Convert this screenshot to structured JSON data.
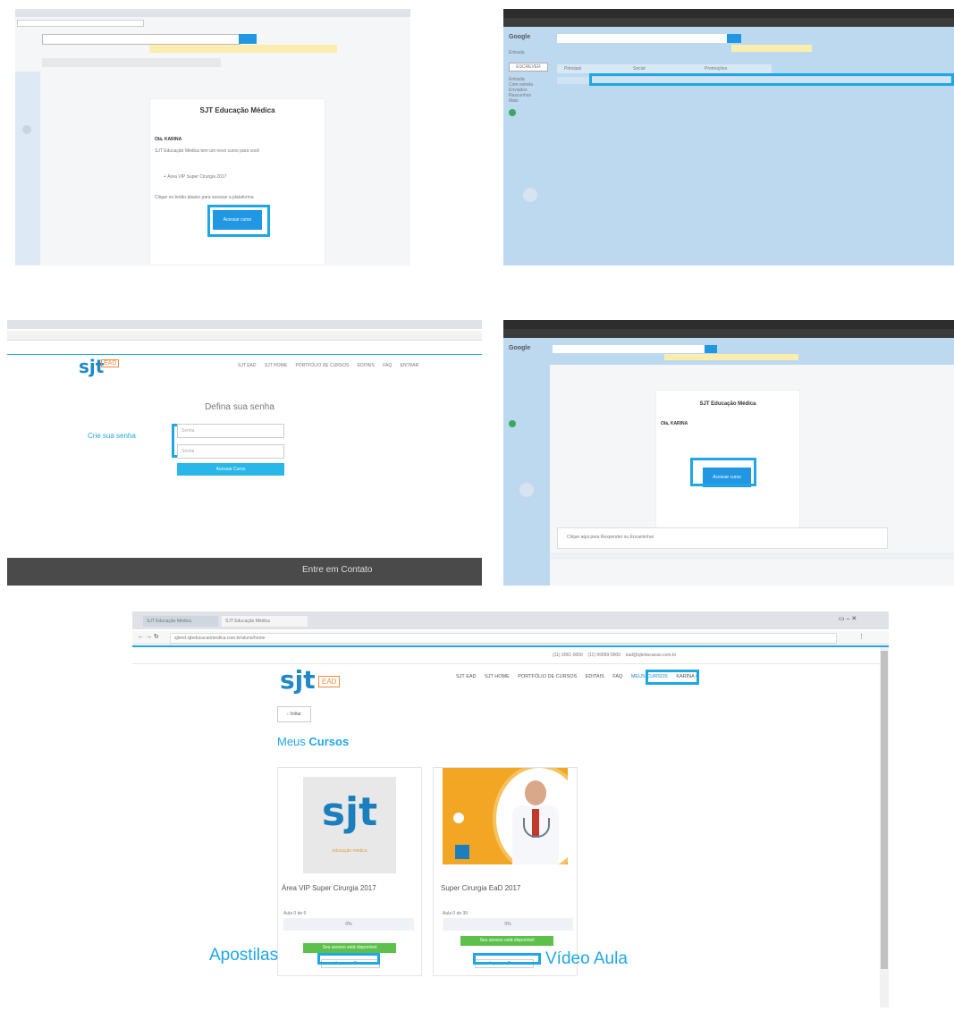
{
  "annotations": {
    "create_password": "Crie sua senha",
    "handouts": "Apostilas",
    "video_class": "Vídeo Aula"
  },
  "panel1": {
    "email_heading": "SJT Educação Médica",
    "greeting": "Olá, KARINA",
    "body_line": "SJT Educação Médica tem um novo curso para você",
    "course_item": "+ Área VIP Super Cirurgia 2017",
    "footer_line": "Clique no botão abaixo para acessar a plataforma",
    "button": "Acessar curso"
  },
  "panel2": {
    "app_name": "Google",
    "inbox_label": "Entrada",
    "compose_label": "ESCREVER",
    "tabs": [
      "Principal",
      "Social",
      "Promoções"
    ],
    "sidebar_items": [
      "Entrada",
      "Com estrela",
      "Enviados",
      "Rascunhos",
      "Mais"
    ]
  },
  "panel3": {
    "logo": "sjt",
    "logo_badge": "EAD",
    "nav_items": [
      "SJT EAD",
      "SJT HOME",
      "PORTFÓLIO DE CURSOS",
      "EDITAIS",
      "FAQ",
      "ENTRAR"
    ],
    "page_title": "Defina sua senha",
    "password_placeholder": "Senha",
    "confirm_placeholder": "Senha",
    "submit_button": "Acessar Curso",
    "footer_text": "Entre em Contato"
  },
  "panel4": {
    "app_name": "Google",
    "email_heading": "SJT Educação Médica",
    "greeting": "Olá, KARINA",
    "button": "Acessar curso",
    "reply_hint": "Clique aqui para Responder ou Encaminhar"
  },
  "panel5": {
    "tabs": [
      "SJT Educação Médica",
      "SJT Educação Médica"
    ],
    "url": "sjtevd.sjteducacaomedica.com.br/aluno/home",
    "contact_phone_1": "(11) 3061-0000",
    "contact_phone_2": "(11) 99999-0000",
    "contact_email": "ead@sjteducacao.com.br",
    "logo": "sjt",
    "logo_badge": "EAD",
    "nav_items": [
      "SJT EAD",
      "SJT HOME",
      "PORTFÓLIO DE CURSOS",
      "EDITAIS",
      "FAQ",
      "MEUS CURSOS",
      "KARINA ▾"
    ],
    "back_button": "‹ Voltar",
    "page_title_prefix": "Meus",
    "page_title_emphasis": "Cursos",
    "courses": [
      {
        "title": "Área VIP Super Cirurgia 2017",
        "lessons": "Aula 0 de 6",
        "progress": "0%",
        "status": "Seu acesso está disponível",
        "action": "Ir para o Curso",
        "thumb_text": "sjt",
        "thumb_sub": "educação médica"
      },
      {
        "title": "Super Cirurgia EaD 2017",
        "lessons": "Aula 0 de 39",
        "progress": "0%",
        "status": "Seu acesso está disponível",
        "action": "Ir para o Curso",
        "thumb_text": "",
        "thumb_sub": ""
      }
    ]
  },
  "colors": {
    "accent": "#1ea7e4",
    "primary": "#2196e3",
    "success": "#5cc04a",
    "gmail_blue": "#bcd9f0",
    "footer_dark": "#4a4a4a",
    "orange": "#f3a524"
  }
}
